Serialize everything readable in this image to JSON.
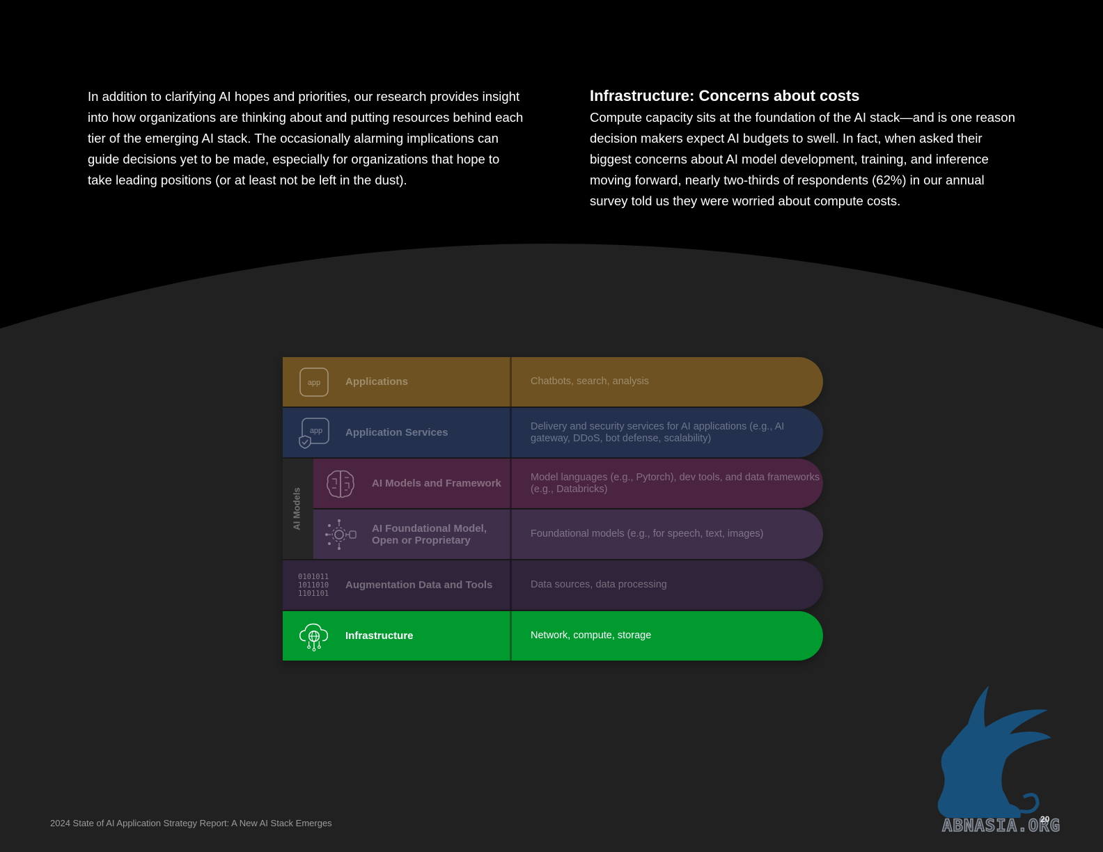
{
  "left_paragraph": "In addition to clarifying AI hopes and priorities, our research provides insight into how organizations are thinking about and putting resources behind each tier of the emerging AI stack. The occasionally alarming implications can guide decisions yet to be made, especially for organizations that hope to take leading positions (or at least not be left in the dust).",
  "right_heading": "Infrastructure: Concerns about costs",
  "right_paragraph": "Compute capacity sits at the foundation of the AI stack—and is one reason decision makers expect AI budgets to swell. In fact, when asked their biggest concerns about AI model development, training, and inference moving forward, nearly two-thirds of respondents (62%) in our annual survey told us they were worried about compute costs.",
  "stack": {
    "group_label": "AI Models",
    "rows": [
      {
        "title": "Applications",
        "description": "Chatbots, search, analysis",
        "icon": "app-icon",
        "icon_text": "app"
      },
      {
        "title": "Application Services",
        "description": "Delivery and security services for AI applications (e.g., AI gateway, DDoS, bot defense, scalability)",
        "icon": "app-shield-icon",
        "icon_text": "app"
      },
      {
        "title": "AI Models and Framework",
        "description": "Model languages (e.g., Pytorch), dev tools, and data frameworks (e.g., Databricks)",
        "icon": "brain-icon"
      },
      {
        "title": "AI Foundational Model, Open or Proprietary",
        "description": "Foundational models (e.g., for speech, text, images)",
        "icon": "network-gear-icon"
      },
      {
        "title": "Augmentation Data and Tools",
        "description": "Data sources, data processing",
        "icon": "binary-icon",
        "icon_text": "0101011 1011010 1101101"
      },
      {
        "title": "Infrastructure",
        "description": "Network, compute, storage",
        "icon": "cloud-globe-icon",
        "highlighted": true
      }
    ]
  },
  "footer": "2024 State of AI Application Strategy Report: A New AI Stack Emerges",
  "page_number": "20",
  "watermark_text": "ABNASIA.ORG",
  "colors": {
    "background_top": "#000000",
    "background_bottom": "#212121",
    "applications": "#6e5222",
    "application_services": "#23314f",
    "ai_models": "#4a2440",
    "foundational": "#3f2f4b",
    "augmentation": "#2f2439",
    "infrastructure": "#019a2e"
  }
}
